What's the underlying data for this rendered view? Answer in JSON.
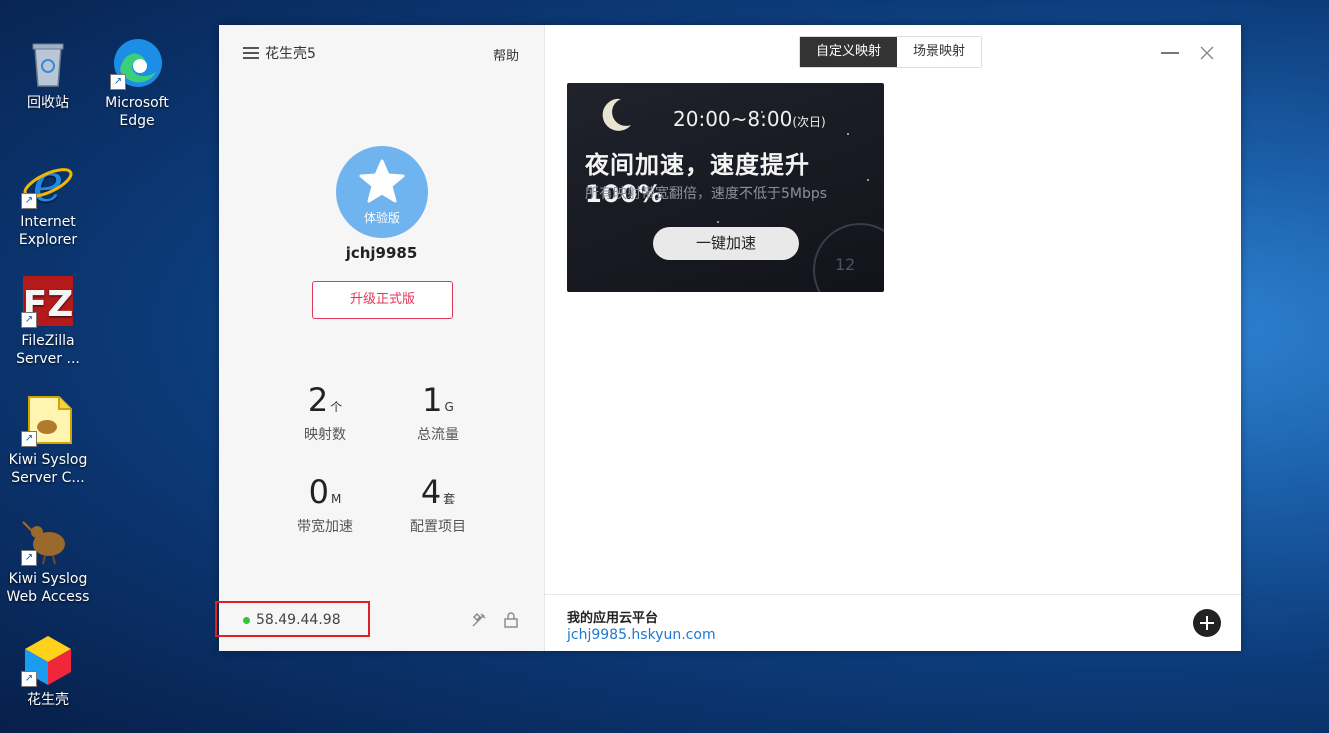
{
  "desktop": {
    "icons": [
      {
        "label": "回收站"
      },
      {
        "label": "Microsoft\nEdge"
      },
      {
        "label": "Internet\nExplorer"
      },
      {
        "label": "FileZilla\nServer ..."
      },
      {
        "label": "Kiwi Syslog\nServer C..."
      },
      {
        "label": "Kiwi Syslog\nWeb Access"
      },
      {
        "label": "花生壳"
      }
    ]
  },
  "app": {
    "name": "花生壳5",
    "help_label": "帮助",
    "tabs": [
      {
        "label": "自定义映射",
        "active": true
      },
      {
        "label": "场景映射",
        "active": false
      }
    ],
    "user": {
      "badge": "体验版",
      "username": "jchj9985",
      "upgrade_label": "升级正式版"
    },
    "stats": [
      {
        "value": "2",
        "unit": "个",
        "label": "映射数"
      },
      {
        "value": "1",
        "unit": "G",
        "label": "总流量"
      },
      {
        "value": "0",
        "unit": "M",
        "label": "带宽加速"
      },
      {
        "value": "4",
        "unit": "套",
        "label": "配置项目"
      }
    ],
    "ip": "58.49.44.98",
    "banner": {
      "time": "20:00~8:00",
      "time_note": "(次日)",
      "title": "夜间加速，速度提升100%",
      "subtitle": "所有映射带宽翻倍，速度不低于5Mbps",
      "button_label": "一键加速",
      "clock_number": "12"
    },
    "cloud": {
      "title": "我的应用云平台",
      "domain": "jchj9985.hskyun.com"
    },
    "colors": {
      "accent": "#e0375b",
      "avatar": "#6fb3ef",
      "online": "#39c03c",
      "link": "#1e78d4"
    }
  }
}
